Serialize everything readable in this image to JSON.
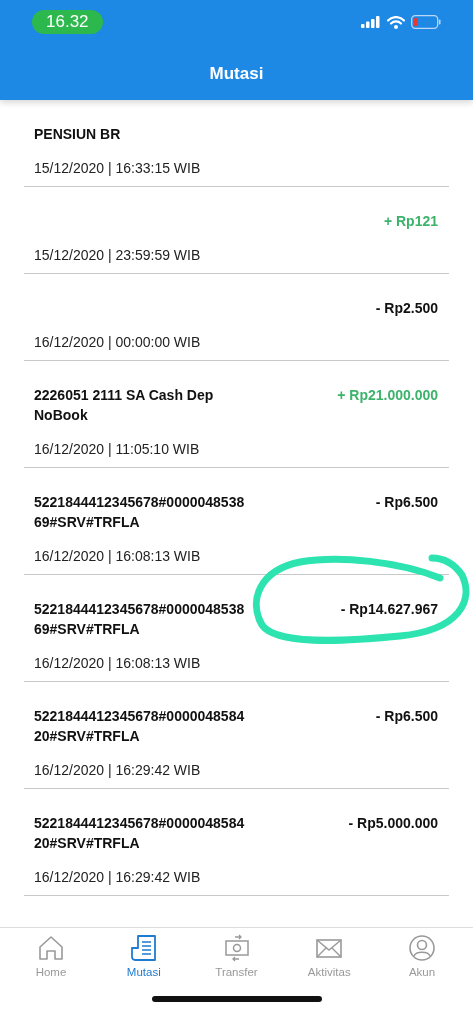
{
  "status_bar": {
    "time": "16.32"
  },
  "header": {
    "title": "Mutasi"
  },
  "transactions": [
    {
      "description": "PENSIUN BR",
      "datetime": "15/12/2020 | 16:33:15 WIB"
    },
    {
      "amount": "+ Rp121",
      "kind": "credit",
      "datetime": "15/12/2020 | 23:59:59 WIB"
    },
    {
      "amount": "- Rp2.500",
      "kind": "debit",
      "datetime": "16/12/2020 | 00:00:00 WIB"
    },
    {
      "description": "2226051  2111 SA Cash Dep NoBook",
      "amount": "+ Rp21.000.000",
      "kind": "credit",
      "datetime": "16/12/2020 | 11:05:10 WIB"
    },
    {
      "description": "5221844412345678#000004853869#SRV#TRFLA",
      "amount": "- Rp6.500",
      "kind": "debit",
      "datetime": "16/12/2020 | 16:08:13 WIB"
    },
    {
      "description": "5221844412345678#000004853869#SRV#TRFLA",
      "amount": "- Rp14.627.967",
      "kind": "debit",
      "datetime": "16/12/2020 | 16:08:13 WIB"
    },
    {
      "description": "5221844412345678#000004858420#SRV#TRFLA",
      "amount": "- Rp6.500",
      "kind": "debit",
      "datetime": "16/12/2020 | 16:29:42 WIB"
    },
    {
      "description": "5221844412345678#000004858420#SRV#TRFLA",
      "amount": "- Rp5.000.000",
      "kind": "debit",
      "datetime": "16/12/2020 | 16:29:42 WIB"
    }
  ],
  "tabs": [
    {
      "label": "Home",
      "kind": "home",
      "selected": false
    },
    {
      "label": "Mutasi",
      "kind": "mutasi",
      "selected": true
    },
    {
      "label": "Transfer",
      "kind": "transfer",
      "selected": false
    },
    {
      "label": "Aktivitas",
      "kind": "aktivitas",
      "selected": false
    },
    {
      "label": "Akun",
      "kind": "akun",
      "selected": false
    }
  ]
}
